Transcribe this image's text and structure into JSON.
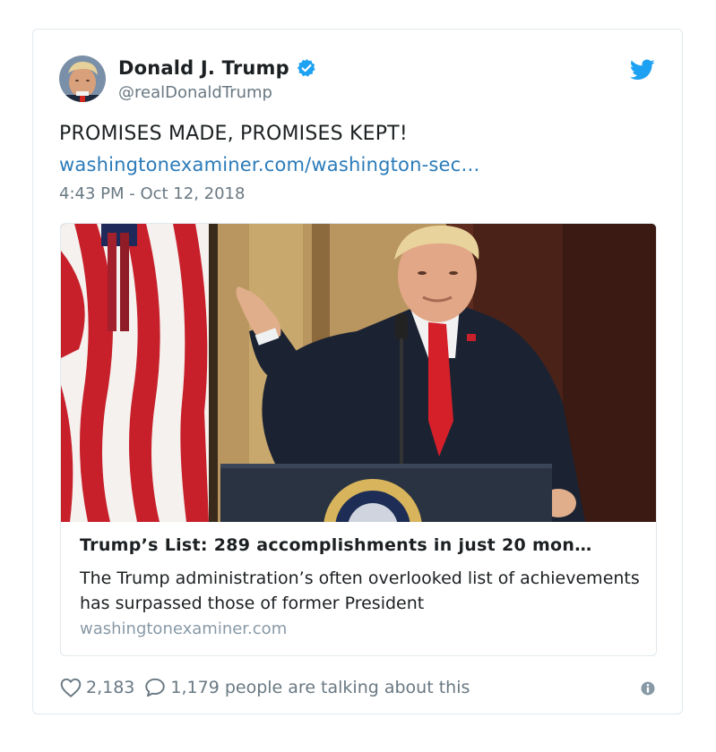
{
  "author": {
    "name": "Donald J. Trump",
    "handle": "@realDonaldTrump",
    "verified_icon": "verified-badge-icon",
    "avatar_icon": "avatar-portrait"
  },
  "brand_icon": "twitter-bird-icon",
  "tweet": {
    "text": "PROMISES MADE, PROMISES KEPT!",
    "link_text": "washingtonexaminer.com/washington-sec…",
    "timestamp": "4:43 PM - Oct 12, 2018"
  },
  "card": {
    "image_description_icon": "article-photo",
    "title": "Trump’s List: 289 accomplishments in just 20 mon…",
    "description": "The Trump administration’s often overlooked list of achievements has surpassed those of former President",
    "domain": "washingtonexaminer.com"
  },
  "actions": {
    "like_count": "2,183",
    "reply_text": "1,179 people are talking about this",
    "info_icon": "info-icon"
  },
  "colors": {
    "link": "#2b7bb9",
    "verified": "#1da1f2",
    "muted": "#697882",
    "border": "#e1e8ed"
  }
}
